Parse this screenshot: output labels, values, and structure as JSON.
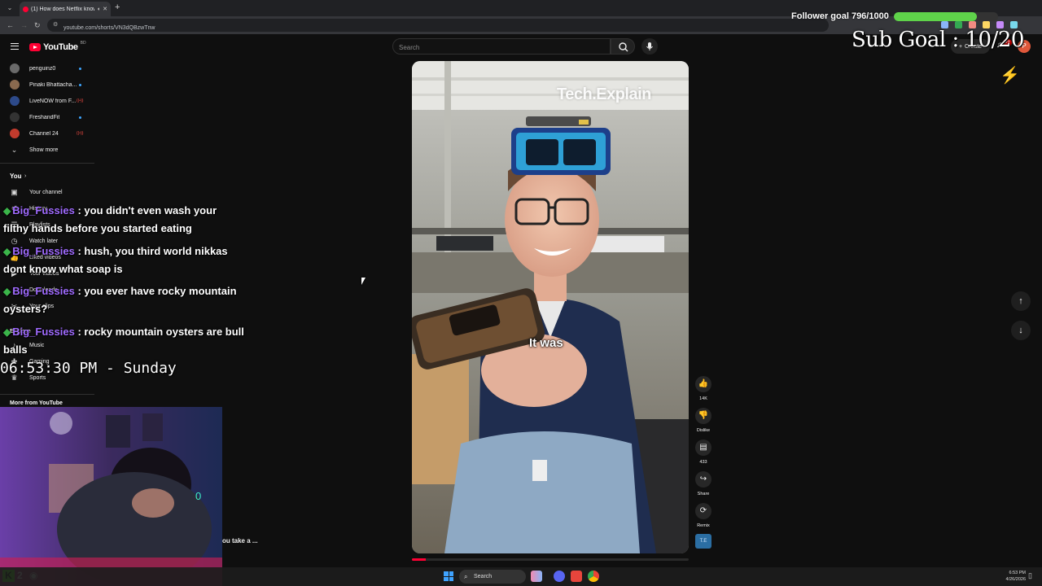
{
  "browser": {
    "tab_title": "(1) How does Netflix know...",
    "url": "youtube.com/shorts/VN3dQBzwTnw"
  },
  "youtube": {
    "logo_text": "YouTube",
    "logo_region": "BD",
    "search_placeholder": "Search",
    "create_label": "Create",
    "notification_count": "9+",
    "avatar_letter": "P"
  },
  "sidebar": {
    "subscriptions": [
      {
        "name": "penguinz0",
        "indicator": "dot",
        "avatar_color": "#6a6a6a"
      },
      {
        "name": "Pinaki Bhattacha...",
        "indicator": "dot",
        "avatar_color": "#8a6a4f"
      },
      {
        "name": "LiveNOW from F...",
        "indicator": "live",
        "avatar_color": "#2d4a8a"
      },
      {
        "name": "FreshandFit",
        "indicator": "dot",
        "avatar_color": "#333333"
      },
      {
        "name": "Channel 24",
        "indicator": "live",
        "avatar_color": "#c23b2d"
      }
    ],
    "show_more_label": "Show more",
    "you_heading": "You",
    "you_items": [
      {
        "label": "Your channel",
        "icon": "person-box-icon"
      },
      {
        "label": "History",
        "icon": "history-icon"
      },
      {
        "label": "Playlists",
        "icon": "playlist-icon"
      },
      {
        "label": "Watch later",
        "icon": "clock-icon"
      },
      {
        "label": "Liked videos",
        "icon": "thumb-up-icon"
      },
      {
        "label": "Your videos",
        "icon": "video-icon"
      },
      {
        "label": "Downloads",
        "icon": "download-icon"
      },
      {
        "label": "Your clips",
        "icon": "scissors-icon"
      }
    ],
    "explore_heading": "Explore",
    "explore_items": [
      {
        "label": "Music",
        "icon": "music-icon"
      },
      {
        "label": "Gaming",
        "icon": "gamepad-icon"
      },
      {
        "label": "Sports",
        "icon": "trophy-icon"
      }
    ],
    "more_from_heading": "More from YouTube"
  },
  "shorts": {
    "watermark": "Tech.Explain",
    "caption": "It was",
    "progress": 0.05,
    "actions": [
      {
        "name": "like",
        "icon": "thumb-up-icon",
        "label": "14K"
      },
      {
        "name": "dislike",
        "icon": "thumb-down-icon",
        "label": "Dislike"
      },
      {
        "name": "comments",
        "icon": "comment-icon",
        "label": "433"
      },
      {
        "name": "share",
        "icon": "share-icon",
        "label": "Share"
      },
      {
        "name": "remix",
        "icon": "remix-icon",
        "label": "Remix"
      }
    ],
    "channel_initials": "T.E"
  },
  "overlay": {
    "follower_goal_text": "Follower goal 796/1000",
    "follower_progress": 0.796,
    "sub_goal_text": "Sub Goal : 10/20",
    "chat": [
      {
        "user": "Big_Fussies",
        "text": ": you didn't even wash your filthy hands before you started eating"
      },
      {
        "user": "Big_Fussies",
        "text": ": hush, you third world nikkas dont know what soap is"
      },
      {
        "user": "Big_Fussies",
        "text": ": you ever have rocky mountain oysters?"
      },
      {
        "user": "Big_Fussies",
        "text": ": rocky mountain oysters are bull balls"
      }
    ],
    "clock": "06:53:30 PM - Sunday",
    "truncated_caption": "ou take a ...",
    "viewer_count": "2",
    "accent_color": "#a06bff"
  },
  "taskbar": {
    "search_label": "Search",
    "time": "6:53 PM",
    "date": "4/26/2026"
  }
}
